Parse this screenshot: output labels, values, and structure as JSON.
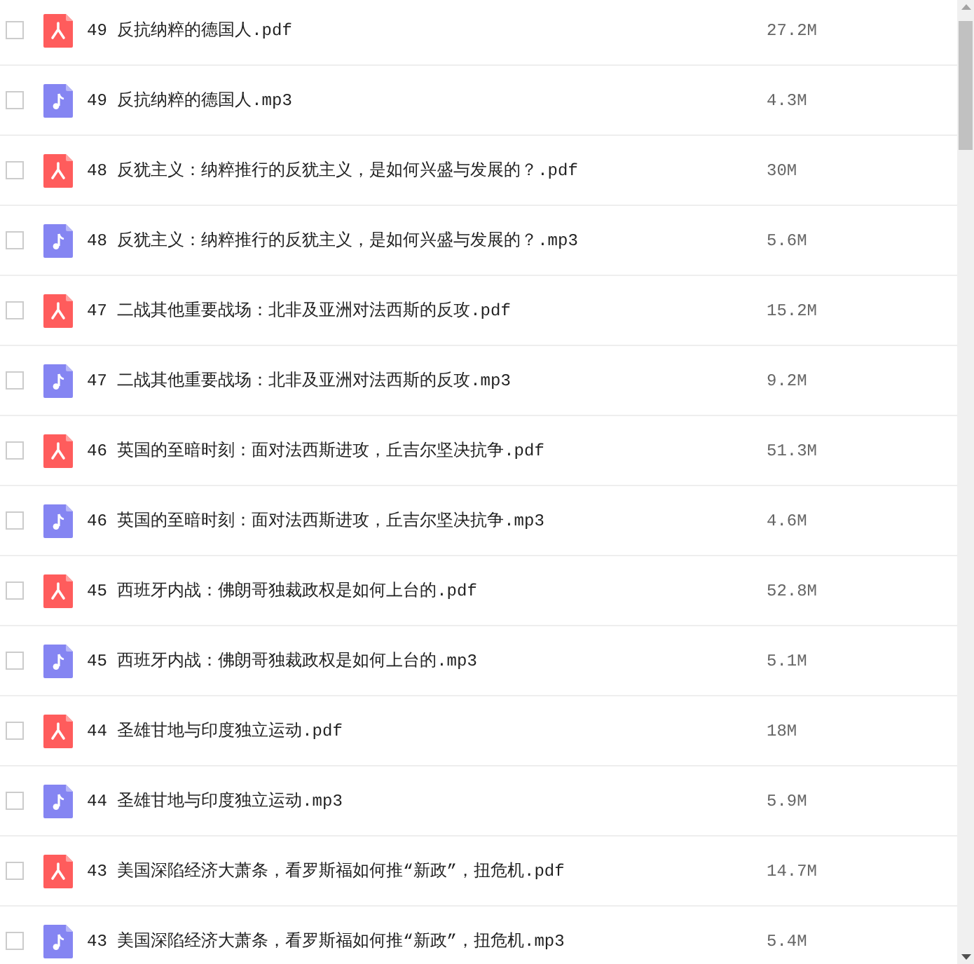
{
  "files": [
    {
      "name": "49 反抗纳粹的德国人.pdf",
      "size": "27.2M",
      "kind": "pdf",
      "checked": false
    },
    {
      "name": "49 反抗纳粹的德国人.mp3",
      "size": "4.3M",
      "kind": "mp3",
      "checked": false
    },
    {
      "name": "48 反犹主义：纳粹推行的反犹主义，是如何兴盛与发展的？.pdf",
      "size": "30M",
      "kind": "pdf",
      "checked": false
    },
    {
      "name": "48 反犹主义：纳粹推行的反犹主义，是如何兴盛与发展的？.mp3",
      "size": "5.6M",
      "kind": "mp3",
      "checked": false
    },
    {
      "name": "47 二战其他重要战场：北非及亚洲对法西斯的反攻.pdf",
      "size": "15.2M",
      "kind": "pdf",
      "checked": false
    },
    {
      "name": "47 二战其他重要战场：北非及亚洲对法西斯的反攻.mp3",
      "size": "9.2M",
      "kind": "mp3",
      "checked": false
    },
    {
      "name": "46 英国的至暗时刻：面对法西斯进攻，丘吉尔坚决抗争.pdf",
      "size": "51.3M",
      "kind": "pdf",
      "checked": false
    },
    {
      "name": "46 英国的至暗时刻：面对法西斯进攻，丘吉尔坚决抗争.mp3",
      "size": "4.6M",
      "kind": "mp3",
      "checked": false
    },
    {
      "name": "45 西班牙内战：佛朗哥独裁政权是如何上台的.pdf",
      "size": "52.8M",
      "kind": "pdf",
      "checked": false
    },
    {
      "name": "45 西班牙内战：佛朗哥独裁政权是如何上台的.mp3",
      "size": "5.1M",
      "kind": "mp3",
      "checked": false
    },
    {
      "name": "44 圣雄甘地与印度独立运动.pdf",
      "size": "18M",
      "kind": "pdf",
      "checked": false
    },
    {
      "name": "44 圣雄甘地与印度独立运动.mp3",
      "size": "5.9M",
      "kind": "mp3",
      "checked": false
    },
    {
      "name": "43 美国深陷经济大萧条，看罗斯福如何推“新政”，扭危机.pdf",
      "size": "14.7M",
      "kind": "pdf",
      "checked": false
    },
    {
      "name": "43 美国深陷经济大萧条，看罗斯福如何推“新政”，扭危机.mp3",
      "size": "5.4M",
      "kind": "mp3",
      "checked": false
    }
  ]
}
